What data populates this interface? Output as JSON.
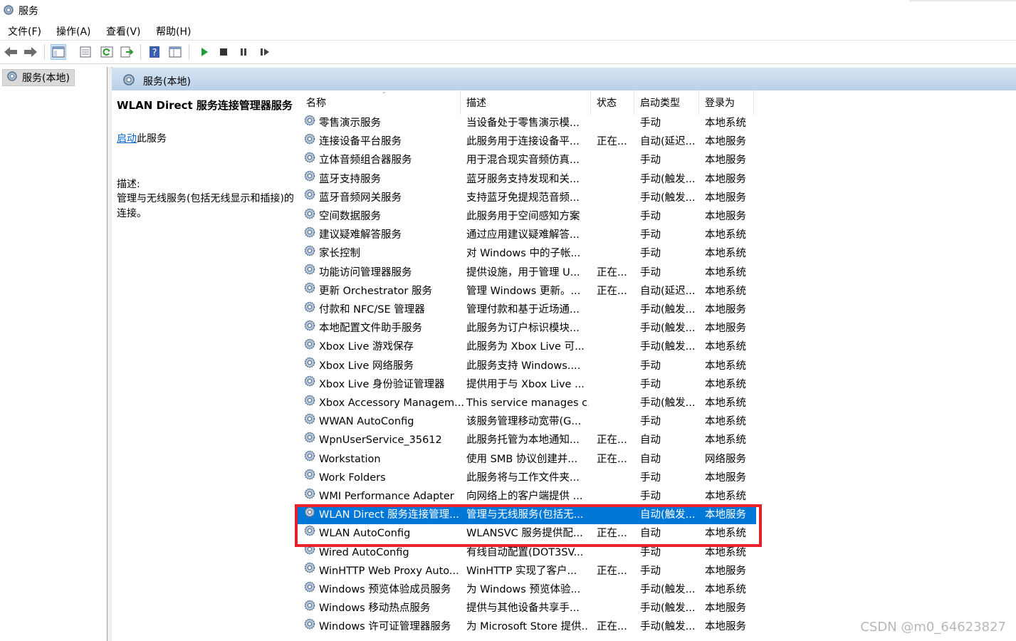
{
  "window": {
    "title": "服务",
    "icon": "services-gear-icon"
  },
  "menu": [
    {
      "label": "文件(F)"
    },
    {
      "label": "操作(A)"
    },
    {
      "label": "查看(V)"
    },
    {
      "label": "帮助(H)"
    }
  ],
  "toolbar": {
    "buttons": [
      "back-icon",
      "forward-icon",
      "show-tree-icon",
      "properties-icon",
      "refresh-icon",
      "export-list-icon",
      "help-icon",
      "view-icon",
      "start-service-icon",
      "stop-service-icon",
      "pause-service-icon",
      "resume-service-icon"
    ]
  },
  "tree": {
    "root_label": "服务(本地)"
  },
  "panel": {
    "header_title": "服务(本地)"
  },
  "details": {
    "service_name": "WLAN Direct 服务连接管理器服务",
    "start_link": "启动",
    "start_suffix": "此服务",
    "desc_label": "描述:",
    "desc_text": "管理与无线服务(包括无线显示和插接)的连接。"
  },
  "columns": {
    "name": "名称",
    "description": "描述",
    "status": "状态",
    "startup": "启动类型",
    "logon": "登录为"
  },
  "services": [
    {
      "name": "零售演示服务",
      "desc": "当设备处于零售演示模...",
      "status": "",
      "startup": "手动",
      "logon": "本地系统"
    },
    {
      "name": "连接设备平台服务",
      "desc": "此服务用于连接设备平...",
      "status": "正在...",
      "startup": "自动(延迟...",
      "logon": "本地服务"
    },
    {
      "name": "立体音频组合器服务",
      "desc": "用于混合现实音频仿真...",
      "status": "",
      "startup": "手动",
      "logon": "本地服务"
    },
    {
      "name": "蓝牙支持服务",
      "desc": "蓝牙服务支持发现和关...",
      "status": "",
      "startup": "手动(触发...",
      "logon": "本地服务"
    },
    {
      "name": "蓝牙音频网关服务",
      "desc": "支持蓝牙免提规范音频...",
      "status": "",
      "startup": "手动(触发...",
      "logon": "本地服务"
    },
    {
      "name": "空间数据服务",
      "desc": "此服务用于空间感知方案",
      "status": "",
      "startup": "手动",
      "logon": "本地服务"
    },
    {
      "name": "建议疑难解答服务",
      "desc": "通过应用建议疑难解答...",
      "status": "",
      "startup": "手动",
      "logon": "本地系统"
    },
    {
      "name": "家长控制",
      "desc": "对 Windows 中的子帐...",
      "status": "",
      "startup": "手动",
      "logon": "本地系统"
    },
    {
      "name": "功能访问管理器服务",
      "desc": "提供设施，用于管理 U...",
      "status": "正在...",
      "startup": "手动",
      "logon": "本地系统"
    },
    {
      "name": "更新 Orchestrator 服务",
      "desc": "管理 Windows 更新。...",
      "status": "正在...",
      "startup": "自动(延迟...",
      "logon": "本地系统"
    },
    {
      "name": "付款和 NFC/SE 管理器",
      "desc": "管理付款和基于近场通...",
      "status": "",
      "startup": "手动(触发...",
      "logon": "本地服务"
    },
    {
      "name": "本地配置文件助手服务",
      "desc": "此服务为订户标识模块...",
      "status": "",
      "startup": "手动(触发...",
      "logon": "本地服务"
    },
    {
      "name": "Xbox Live 游戏保存",
      "desc": "此服务为 Xbox Live 可...",
      "status": "",
      "startup": "手动(触发...",
      "logon": "本地系统"
    },
    {
      "name": "Xbox Live 网络服务",
      "desc": "此服务支持 Windows....",
      "status": "",
      "startup": "手动",
      "logon": "本地系统"
    },
    {
      "name": "Xbox Live 身份验证管理器",
      "desc": "提供用于与 Xbox Live ...",
      "status": "",
      "startup": "手动",
      "logon": "本地系统"
    },
    {
      "name": "Xbox Accessory Managem...",
      "desc": "This service manages c...",
      "status": "",
      "startup": "手动(触发...",
      "logon": "本地系统"
    },
    {
      "name": "WWAN AutoConfig",
      "desc": "该服务管理移动宽带(G...",
      "status": "",
      "startup": "手动",
      "logon": "本地系统"
    },
    {
      "name": "WpnUserService_35612",
      "desc": "此服务托管为本地通知...",
      "status": "正在...",
      "startup": "自动",
      "logon": "本地系统"
    },
    {
      "name": "Workstation",
      "desc": "使用 SMB 协议创建并...",
      "status": "正在...",
      "startup": "自动",
      "logon": "网络服务"
    },
    {
      "name": "Work Folders",
      "desc": "此服务将与工作文件夹...",
      "status": "",
      "startup": "手动",
      "logon": "本地服务"
    },
    {
      "name": "WMI Performance Adapter",
      "desc": "向网络上的客户端提供 ...",
      "status": "",
      "startup": "手动",
      "logon": "本地系统"
    },
    {
      "name": "WLAN Direct 服务连接管理...",
      "desc": "管理与无线服务(包括无...",
      "status": "",
      "startup": "自动(触发...",
      "logon": "本地服务",
      "selected": true
    },
    {
      "name": "WLAN AutoConfig",
      "desc": "WLANSVC 服务提供配...",
      "status": "正在...",
      "startup": "自动",
      "logon": "本地系统"
    },
    {
      "name": "Wired AutoConfig",
      "desc": "有线自动配置(DOT3SV...",
      "status": "",
      "startup": "手动",
      "logon": "本地系统"
    },
    {
      "name": "WinHTTP Web Proxy Auto...",
      "desc": "WinHTTP 实现了客户...",
      "status": "正在...",
      "startup": "手动",
      "logon": "本地服务"
    },
    {
      "name": "Windows 预览体验成员服务",
      "desc": "为 Windows 预览体验...",
      "status": "",
      "startup": "手动(触发...",
      "logon": "本地系统"
    },
    {
      "name": "Windows 移动热点服务",
      "desc": "提供与其他设备共享手...",
      "status": "",
      "startup": "手动(触发...",
      "logon": "本地服务"
    },
    {
      "name": "Windows 许可证管理器服务",
      "desc": "为 Microsoft Store 提供...",
      "status": "正在...",
      "startup": "手动(触发...",
      "logon": "本地服务"
    }
  ],
  "watermark": "CSDN @m0_64623827",
  "colors": {
    "selection": "#0078d7",
    "highlight_box": "#e8202a",
    "header_band": "#c6d9ee"
  }
}
